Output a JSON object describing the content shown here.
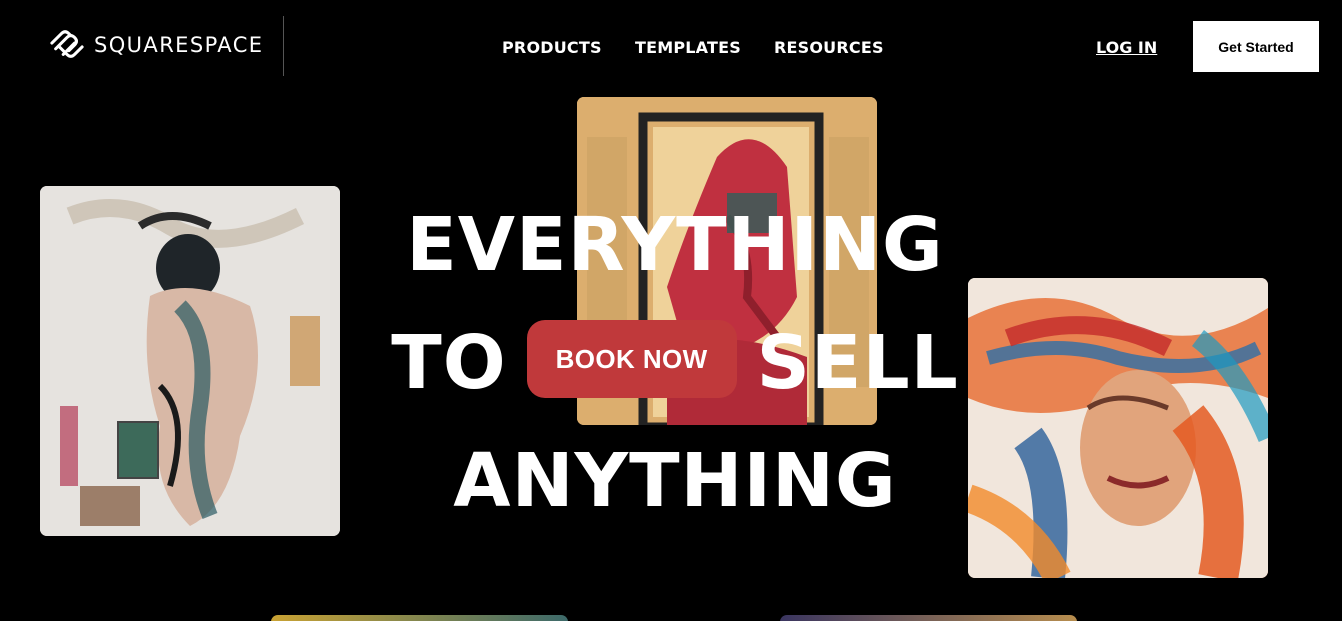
{
  "header": {
    "brand": "SQUARESPACE",
    "nav": [
      "PRODUCTS",
      "TEMPLATES",
      "RESOURCES"
    ],
    "login_label": "LOG IN",
    "cta_label": "Get Started"
  },
  "hero": {
    "line1": "EVERYTHING",
    "line2_left": "TO",
    "line2_right": "SELL",
    "line3": "ANYTHING",
    "book_label": "BOOK NOW"
  },
  "colors": {
    "background": "#000000",
    "accent": "#c0393b",
    "text": "#ffffff"
  },
  "icons": {
    "brand_mark": "squarespace-logo-icon"
  }
}
